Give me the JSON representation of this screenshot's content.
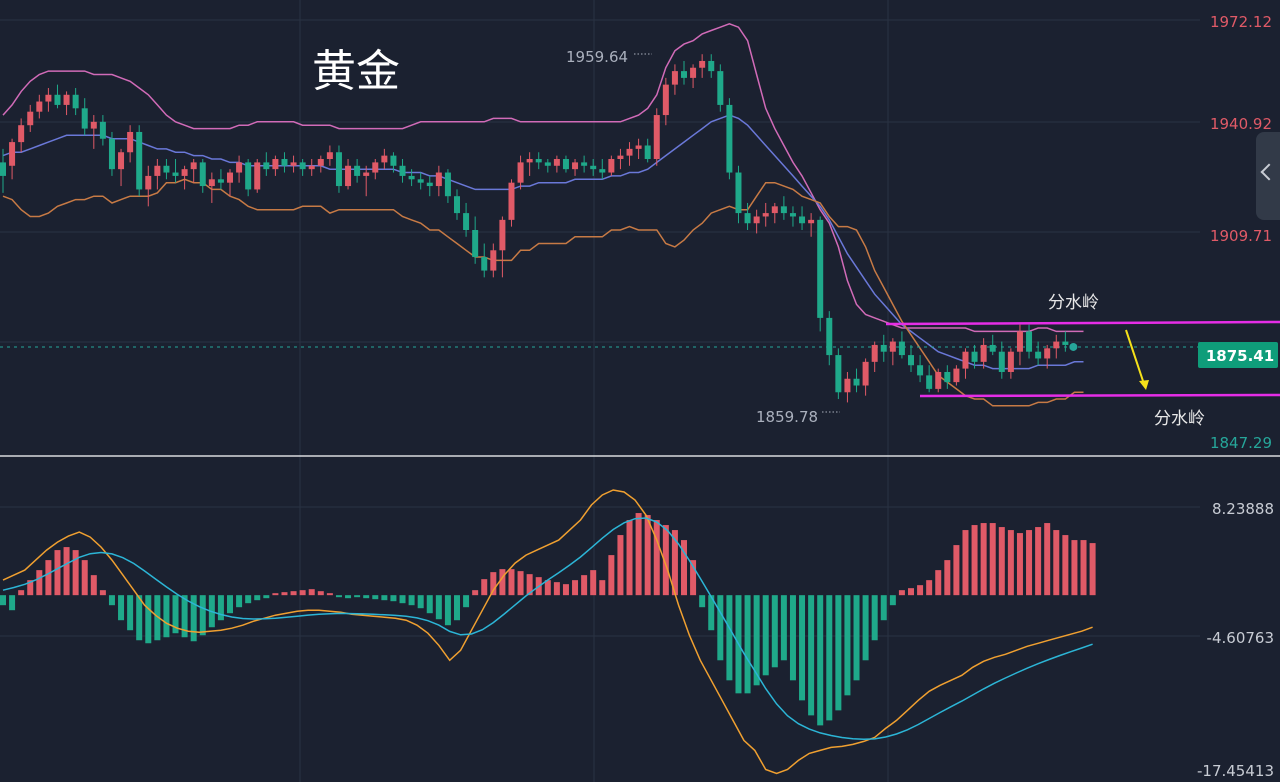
{
  "title": "黄金",
  "chart_data": [
    {
      "type": "candlestick",
      "title": "黄金",
      "price_axis_ticks": [
        "1972.12",
        "1940.92",
        "1909.71",
        "1847.29"
      ],
      "current_price": "1875.41",
      "high_marker": "1959.64",
      "low_marker": "1859.78",
      "annotations": [
        "分水岭",
        "分水岭"
      ],
      "indicators": [
        "bollinger-upper",
        "bollinger-middle",
        "bollinger-lower"
      ],
      "ylim": [
        1847.29,
        1972.12
      ],
      "candles": [
        [
          1930,
          1934,
          1921,
          1926
        ],
        [
          1929,
          1937,
          1925,
          1936
        ],
        [
          1936,
          1943,
          1933,
          1941
        ],
        [
          1941,
          1947,
          1939,
          1945
        ],
        [
          1945,
          1950,
          1943,
          1948
        ],
        [
          1948,
          1952,
          1945,
          1950
        ],
        [
          1950,
          1953,
          1946,
          1947
        ],
        [
          1947,
          1951,
          1944,
          1950
        ],
        [
          1950,
          1952,
          1944,
          1946
        ],
        [
          1946,
          1949,
          1938,
          1940
        ],
        [
          1940,
          1944,
          1934,
          1942
        ],
        [
          1942,
          1944,
          1935,
          1937
        ],
        [
          1937,
          1939,
          1926,
          1928
        ],
        [
          1928,
          1934,
          1923,
          1933
        ],
        [
          1933,
          1941,
          1930,
          1939
        ],
        [
          1939,
          1941,
          1920,
          1922
        ],
        [
          1922,
          1929,
          1917,
          1926
        ],
        [
          1926,
          1931,
          1922,
          1929
        ],
        [
          1929,
          1931,
          1925,
          1927
        ],
        [
          1927,
          1931,
          1924,
          1926
        ],
        [
          1926,
          1929,
          1922,
          1928
        ],
        [
          1928,
          1931,
          1924,
          1930
        ],
        [
          1930,
          1931,
          1921,
          1923
        ],
        [
          1923,
          1927,
          1918,
          1925
        ],
        [
          1925,
          1928,
          1922,
          1924
        ],
        [
          1924,
          1928,
          1920,
          1927
        ],
        [
          1927,
          1932,
          1924,
          1930
        ],
        [
          1930,
          1931,
          1920,
          1922
        ],
        [
          1922,
          1931,
          1921,
          1930
        ],
        [
          1930,
          1933,
          1926,
          1928
        ],
        [
          1928,
          1932,
          1926,
          1931
        ],
        [
          1931,
          1933,
          1927,
          1929
        ],
        [
          1929,
          1932,
          1927,
          1930
        ],
        [
          1930,
          1931,
          1926,
          1928
        ],
        [
          1928,
          1931,
          1926,
          1929
        ],
        [
          1929,
          1932,
          1927,
          1931
        ],
        [
          1931,
          1935,
          1929,
          1933
        ],
        [
          1933,
          1935,
          1921,
          1923
        ],
        [
          1923,
          1931,
          1922,
          1929
        ],
        [
          1929,
          1931,
          1924,
          1926
        ],
        [
          1926,
          1929,
          1920,
          1927
        ],
        [
          1927,
          1931,
          1925,
          1930
        ],
        [
          1930,
          1934,
          1928,
          1932
        ],
        [
          1932,
          1933,
          1927,
          1929
        ],
        [
          1929,
          1931,
          1924,
          1926
        ],
        [
          1926,
          1928,
          1923,
          1925
        ],
        [
          1925,
          1927,
          1922,
          1924
        ],
        [
          1924,
          1926,
          1920,
          1923
        ],
        [
          1923,
          1929,
          1920,
          1927
        ],
        [
          1927,
          1928,
          1918,
          1920
        ],
        [
          1920,
          1922,
          1913,
          1915
        ],
        [
          1915,
          1918,
          1908,
          1910
        ],
        [
          1910,
          1914,
          1900,
          1902
        ],
        [
          1902,
          1906,
          1896,
          1898
        ],
        [
          1898,
          1906,
          1896,
          1904
        ],
        [
          1904,
          1914,
          1896,
          1913
        ],
        [
          1913,
          1925,
          1911,
          1924
        ],
        [
          1924,
          1932,
          1922,
          1930
        ],
        [
          1930,
          1933,
          1926,
          1931
        ],
        [
          1931,
          1933,
          1928,
          1930
        ],
        [
          1930,
          1931,
          1927,
          1929
        ],
        [
          1929,
          1932,
          1927,
          1931
        ],
        [
          1931,
          1932,
          1927,
          1928
        ],
        [
          1928,
          1931,
          1926,
          1930
        ],
        [
          1930,
          1932,
          1927,
          1929
        ],
        [
          1929,
          1931,
          1926,
          1928
        ],
        [
          1928,
          1931,
          1925,
          1927
        ],
        [
          1927,
          1932,
          1926,
          1931
        ],
        [
          1931,
          1934,
          1928,
          1932
        ],
        [
          1932,
          1936,
          1929,
          1934
        ],
        [
          1934,
          1937,
          1931,
          1935
        ],
        [
          1935,
          1937,
          1930,
          1931
        ],
        [
          1931,
          1946,
          1929,
          1944
        ],
        [
          1944,
          1955,
          1941,
          1953
        ],
        [
          1953,
          1959,
          1950,
          1957
        ],
        [
          1957,
          1960,
          1953,
          1955
        ],
        [
          1955,
          1959,
          1952,
          1958
        ],
        [
          1958,
          1962,
          1955,
          1960
        ],
        [
          1960,
          1962,
          1955,
          1957
        ],
        [
          1957,
          1959,
          1945,
          1947
        ],
        [
          1947,
          1949,
          1925,
          1927
        ],
        [
          1927,
          1929,
          1912,
          1915
        ],
        [
          1915,
          1918,
          1910,
          1912
        ],
        [
          1912,
          1916,
          1909,
          1914
        ],
        [
          1914,
          1918,
          1911,
          1915
        ],
        [
          1915,
          1918,
          1912,
          1917
        ],
        [
          1917,
          1920,
          1913,
          1915
        ],
        [
          1915,
          1917,
          1911,
          1914
        ],
        [
          1914,
          1917,
          1910,
          1912
        ],
        [
          1912,
          1915,
          1908,
          1913
        ],
        [
          1913,
          1914,
          1880,
          1884
        ],
        [
          1884,
          1886,
          1870,
          1873
        ],
        [
          1873,
          1875,
          1860,
          1862
        ],
        [
          1862,
          1868,
          1859,
          1866
        ],
        [
          1866,
          1869,
          1862,
          1864
        ],
        [
          1864,
          1872,
          1861,
          1871
        ],
        [
          1871,
          1877,
          1868,
          1876
        ],
        [
          1876,
          1879,
          1871,
          1874
        ],
        [
          1874,
          1878,
          1870,
          1877
        ],
        [
          1877,
          1880,
          1872,
          1873
        ],
        [
          1873,
          1876,
          1868,
          1870
        ],
        [
          1870,
          1873,
          1865,
          1867
        ],
        [
          1867,
          1870,
          1862,
          1863
        ],
        [
          1863,
          1869,
          1862,
          1868
        ],
        [
          1868,
          1870,
          1863,
          1865
        ],
        [
          1865,
          1870,
          1864,
          1869
        ],
        [
          1869,
          1875,
          1866,
          1874
        ],
        [
          1874,
          1876,
          1869,
          1871
        ],
        [
          1871,
          1878,
          1869,
          1876
        ],
        [
          1876,
          1879,
          1873,
          1874
        ],
        [
          1874,
          1877,
          1866,
          1868
        ],
        [
          1868,
          1875,
          1866,
          1874
        ],
        [
          1874,
          1882,
          1870,
          1880
        ],
        [
          1880,
          1882,
          1872,
          1874
        ],
        [
          1874,
          1877,
          1870,
          1872
        ],
        [
          1872,
          1876,
          1869,
          1875
        ],
        [
          1875,
          1879,
          1872,
          1877
        ],
        [
          1877,
          1880,
          1874,
          1876
        ]
      ],
      "boll_upper": [
        1944,
        1947,
        1951,
        1954,
        1956,
        1957,
        1957,
        1957,
        1957,
        1957,
        1956,
        1956,
        1956,
        1955,
        1954,
        1952,
        1950,
        1947,
        1944,
        1942,
        1941,
        1940,
        1940,
        1940,
        1940,
        1940,
        1941,
        1941,
        1942,
        1942,
        1942,
        1942,
        1942,
        1941,
        1941,
        1941,
        1941,
        1940,
        1940,
        1940,
        1940,
        1940,
        1940,
        1940,
        1940,
        1941,
        1942,
        1942,
        1942,
        1942,
        1942,
        1942,
        1942,
        1942,
        1943,
        1943,
        1943,
        1942,
        1942,
        1942,
        1942,
        1942,
        1942,
        1942,
        1942,
        1942,
        1942,
        1942,
        1942,
        1943,
        1944,
        1946,
        1950,
        1958,
        1963,
        1965,
        1966,
        1968,
        1969,
        1970,
        1971,
        1970,
        1966,
        1956,
        1946,
        1940,
        1935,
        1930,
        1926,
        1921,
        1916,
        1912,
        1905,
        1895,
        1888,
        1885,
        1884,
        1883,
        1882,
        1881,
        1881,
        1881,
        1881,
        1881,
        1881,
        1881,
        1881,
        1880,
        1880,
        1880,
        1880,
        1880,
        1880,
        1880,
        1881,
        1881,
        1880,
        1880,
        1880,
        1880
      ],
      "boll_middle": [
        1932,
        1933,
        1933,
        1934,
        1935,
        1936,
        1937,
        1938,
        1938,
        1938,
        1938,
        1938,
        1937,
        1937,
        1937,
        1936,
        1935,
        1934,
        1934,
        1933,
        1933,
        1932,
        1932,
        1931,
        1931,
        1930,
        1930,
        1929,
        1929,
        1929,
        1929,
        1929,
        1929,
        1929,
        1929,
        1929,
        1928,
        1928,
        1928,
        1928,
        1928,
        1928,
        1928,
        1928,
        1927,
        1927,
        1927,
        1926,
        1926,
        1925,
        1924,
        1923,
        1922,
        1922,
        1922,
        1922,
        1922,
        1923,
        1923,
        1924,
        1924,
        1924,
        1924,
        1925,
        1925,
        1925,
        1925,
        1926,
        1926,
        1927,
        1927,
        1928,
        1930,
        1932,
        1934,
        1936,
        1938,
        1940,
        1942,
        1943,
        1944,
        1943,
        1941,
        1938,
        1935,
        1932,
        1929,
        1926,
        1923,
        1920,
        1917,
        1913,
        1908,
        1903,
        1899,
        1895,
        1891,
        1888,
        1885,
        1882,
        1880,
        1878,
        1876,
        1874,
        1873,
        1872,
        1871,
        1870,
        1870,
        1869,
        1869,
        1869,
        1869,
        1869,
        1870,
        1870,
        1870,
        1870,
        1871,
        1871
      ],
      "boll_lower": [
        1920,
        1919,
        1916,
        1914,
        1914,
        1915,
        1917,
        1918,
        1919,
        1919,
        1920,
        1920,
        1918,
        1919,
        1920,
        1920,
        1920,
        1921,
        1924,
        1924,
        1925,
        1924,
        1924,
        1922,
        1922,
        1920,
        1919,
        1917,
        1916,
        1916,
        1916,
        1916,
        1916,
        1917,
        1917,
        1917,
        1915,
        1916,
        1916,
        1916,
        1916,
        1916,
        1916,
        1916,
        1914,
        1913,
        1912,
        1910,
        1910,
        1908,
        1906,
        1904,
        1902,
        1902,
        1901,
        1901,
        1901,
        1904,
        1904,
        1906,
        1906,
        1906,
        1906,
        1908,
        1908,
        1908,
        1908,
        1910,
        1910,
        1911,
        1910,
        1910,
        1910,
        1906,
        1905,
        1907,
        1910,
        1912,
        1915,
        1916,
        1917,
        1916,
        1916,
        1920,
        1924,
        1924,
        1923,
        1922,
        1920,
        1919,
        1918,
        1914,
        1911,
        1911,
        1910,
        1905,
        1898,
        1893,
        1888,
        1883,
        1879,
        1875,
        1871,
        1867,
        1865,
        1863,
        1861,
        1860,
        1860,
        1858,
        1858,
        1858,
        1858,
        1858,
        1859,
        1859,
        1860,
        1860,
        1862,
        1862
      ]
    },
    {
      "type": "macd",
      "axis_ticks": [
        "8.23888",
        "-4.60763",
        "-17.45413"
      ],
      "ylim": [
        -17.45413,
        10.5
      ],
      "hist": [
        -1,
        -1.5,
        0.5,
        1.5,
        2.5,
        3.5,
        4.5,
        4.8,
        4.5,
        3.5,
        2,
        0.5,
        -1,
        -2.5,
        -3.5,
        -4.5,
        -4.8,
        -4.5,
        -4.2,
        -3.8,
        -4.2,
        -4.6,
        -4,
        -3.2,
        -2.5,
        -1.8,
        -1.2,
        -0.8,
        -0.5,
        -0.3,
        0.2,
        0.3,
        0.4,
        0.5,
        0.6,
        0.4,
        0.2,
        -0.2,
        -0.3,
        -0.2,
        -0.3,
        -0.4,
        -0.5,
        -0.6,
        -0.8,
        -1,
        -1.3,
        -1.8,
        -2.4,
        -3,
        -2.5,
        -1.2,
        0.5,
        1.6,
        2.3,
        2.6,
        2.6,
        2.4,
        2.1,
        1.8,
        1.5,
        1.3,
        1.1,
        1.5,
        2,
        2.5,
        1.5,
        4,
        6,
        7.5,
        8.2,
        8,
        7.5,
        7,
        6.5,
        5.5,
        3.5,
        -1.2,
        -3.5,
        -6.5,
        -8.5,
        -9.8,
        -9.8,
        -9,
        -8,
        -7.2,
        -6.5,
        -8.5,
        -10.5,
        -12,
        -13,
        -12.5,
        -11.5,
        -10,
        -8.5,
        -6.5,
        -4.5,
        -2.5,
        -1,
        0.5,
        0.7,
        1,
        1.5,
        2.5,
        3.5,
        5,
        6.5,
        7,
        7.2,
        7.2,
        6.8,
        6.5,
        6.2,
        6.5,
        6.8,
        7.2,
        6.5,
        6,
        5.5,
        5.5,
        5.2
      ],
      "dif": [
        1.5,
        2,
        2.5,
        3.5,
        4.5,
        5.3,
        5.9,
        6.3,
        5.8,
        4.8,
        3.5,
        2,
        0.5,
        -1,
        -2,
        -2.8,
        -3.3,
        -3.6,
        -3.7,
        -3.6,
        -3.5,
        -3.3,
        -3,
        -2.6,
        -2.3,
        -2,
        -1.8,
        -1.6,
        -1.5,
        -1.5,
        -1.6,
        -1.7,
        -1.9,
        -2,
        -2.1,
        -2.2,
        -2.3,
        -2.5,
        -3,
        -3.8,
        -5,
        -6.5,
        -5.5,
        -3.5,
        -1.5,
        0.5,
        2,
        3.2,
        4,
        4.5,
        5,
        5.5,
        6.5,
        7.5,
        9,
        10,
        10.5,
        10.3,
        9.5,
        8,
        5.5,
        2.5,
        -1,
        -4,
        -6.5,
        -8.5,
        -10.5,
        -12.5,
        -14.5,
        -15.5,
        -17.4,
        -17.8,
        -17.4,
        -16.5,
        -15.8,
        -15.5,
        -15.2,
        -15.1,
        -14.9,
        -14.6,
        -14.2,
        -13.3,
        -12.5,
        -11.5,
        -10.5,
        -9.6,
        -9,
        -8.5,
        -8,
        -7.2,
        -6.6,
        -6.2,
        -5.9,
        -5.5,
        -5.1,
        -4.8,
        -4.5,
        -4.2,
        -3.9,
        -3.6,
        -3.2
      ]
    }
  ]
}
